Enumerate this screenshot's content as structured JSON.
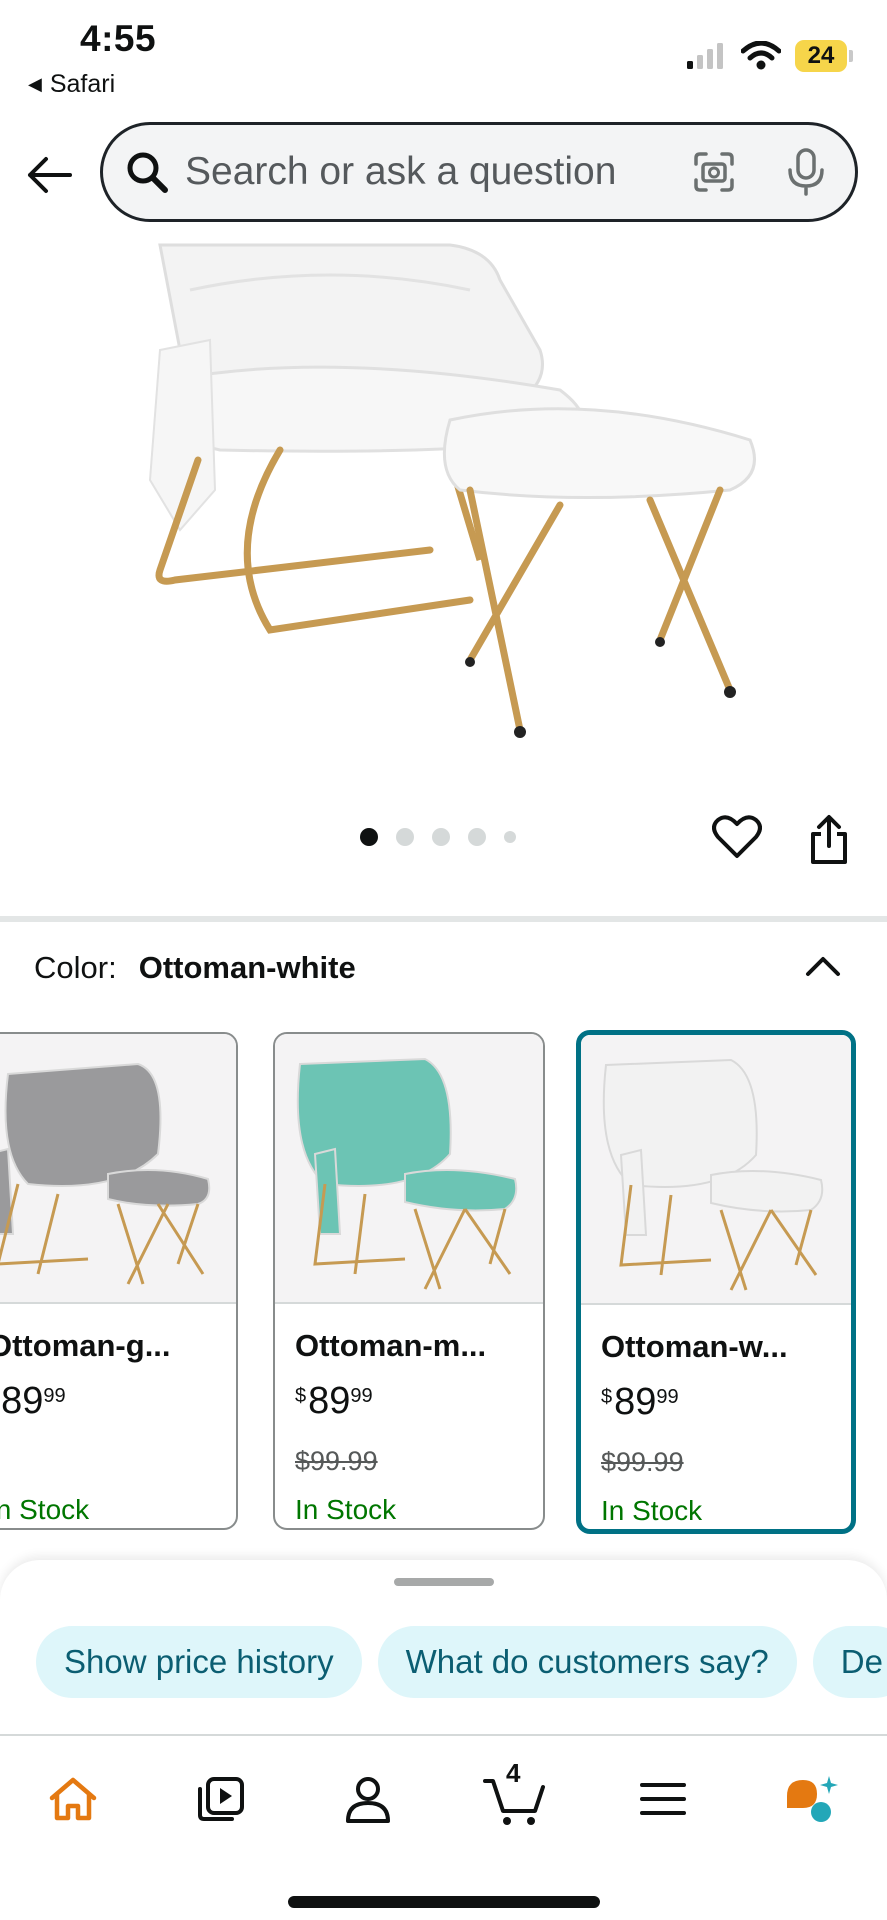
{
  "status_bar": {
    "time": "4:55",
    "back_app": "Safari",
    "battery": "24"
  },
  "search": {
    "placeholder": "Search or ask a question"
  },
  "carousel": {
    "total": 5,
    "active": 1
  },
  "color": {
    "label": "Color:",
    "value": "Ottoman-white"
  },
  "swatches": [
    {
      "name": "Ottoman-g...",
      "currency": "$",
      "price_whole": "89",
      "price_cents": "99",
      "old_price": "",
      "stock": "In Stock",
      "color": "#9a9a9c",
      "selected": false
    },
    {
      "name": "Ottoman-m...",
      "currency": "$",
      "price_whole": "89",
      "price_cents": "99",
      "old_price": "$99.99",
      "stock": "In Stock",
      "color": "#6cc4b4",
      "selected": false
    },
    {
      "name": "Ottoman-w...",
      "currency": "$",
      "price_whole": "89",
      "price_cents": "99",
      "old_price": "$99.99",
      "stock": "In Stock",
      "color": "#f2f2f2",
      "selected": true
    }
  ],
  "chips": [
    "Show price history",
    "What do customers say?",
    "De"
  ],
  "tabbar": {
    "cart_count": "4",
    "accent": "#e47911",
    "rufus_teal": "#23a7b8"
  }
}
